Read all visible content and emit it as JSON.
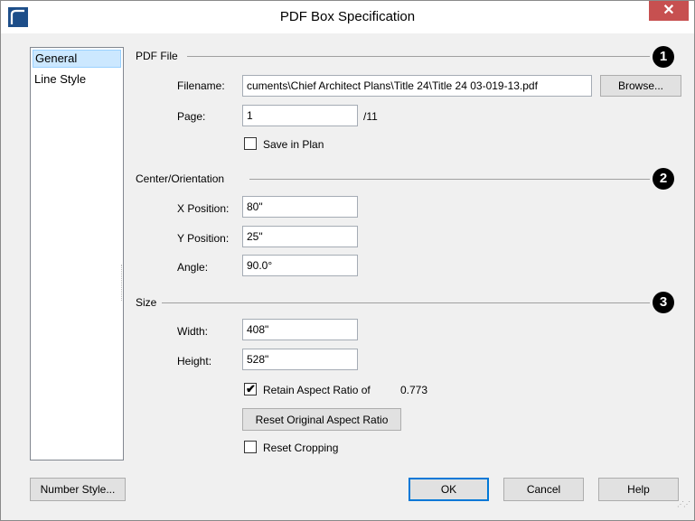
{
  "window": {
    "title": "PDF Box Specification",
    "close_symbol": "✕"
  },
  "nav": {
    "items": [
      {
        "label": "General",
        "selected": true
      },
      {
        "label": "Line Style",
        "selected": false
      }
    ]
  },
  "pdf_file": {
    "section_label": "PDF File",
    "badge": "1",
    "filename_label": "Filename:",
    "filename_value": "cuments\\Chief Architect Plans\\Title 24\\Title 24 03-019-13.pdf",
    "browse_label": "Browse...",
    "page_label": "Page:",
    "page_value": "1",
    "page_total": "/11",
    "save_in_plan_label": "Save in Plan",
    "save_in_plan_checked": false
  },
  "center_orientation": {
    "section_label": "Center/Orientation",
    "badge": "2",
    "x_label": "X Position:",
    "x_value": "80\"",
    "y_label": "Y Position:",
    "y_value": "25\"",
    "angle_label": "Angle:",
    "angle_value": "90.0°"
  },
  "size": {
    "section_label": "Size",
    "badge": "3",
    "width_label": "Width:",
    "width_value": "408\"",
    "height_label": "Height:",
    "height_value": "528\"",
    "retain_label": "Retain Aspect Ratio of",
    "retain_checked": true,
    "aspect_ratio": "0.773",
    "reset_aspect_label": "Reset Original Aspect Ratio",
    "reset_cropping_label": "Reset Cropping",
    "reset_cropping_checked": false
  },
  "footer": {
    "number_style_label": "Number Style...",
    "ok_label": "OK",
    "cancel_label": "Cancel",
    "help_label": "Help"
  },
  "colors": {
    "close_button": "#c75050",
    "selection": "#cce8ff",
    "default_button_border": "#0078d7"
  }
}
